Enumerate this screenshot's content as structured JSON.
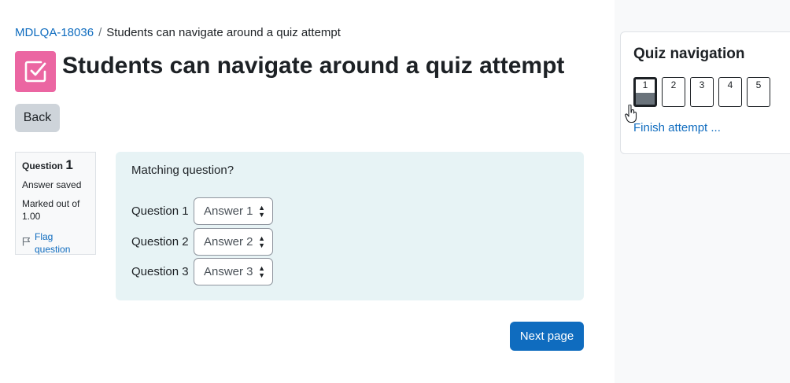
{
  "breadcrumb": {
    "course": "MDLQA-18036",
    "separator": "/",
    "current": "Students can navigate around a quiz attempt"
  },
  "page": {
    "title": "Students can navigate around a quiz attempt",
    "icon": "quiz-checkbox-icon",
    "back_label": "Back"
  },
  "question_info": {
    "label": "Question",
    "number": "1",
    "state": "Answer saved",
    "mark": "Marked out of 1.00",
    "flag_label": "Flag question"
  },
  "question": {
    "text": "Matching question?",
    "rows": [
      {
        "label": "Question 1",
        "selected": "Answer 1"
      },
      {
        "label": "Question 2",
        "selected": "Answer 2"
      },
      {
        "label": "Question 3",
        "selected": "Answer 3"
      }
    ]
  },
  "next_label": "Next page",
  "navigation": {
    "title": "Quiz navigation",
    "buttons": [
      "1",
      "2",
      "3",
      "4",
      "5"
    ],
    "current": "1",
    "finish_label": "Finish attempt ..."
  },
  "colors": {
    "accent": "#0f6cbf",
    "quiz_icon": "#eb66a2",
    "question_bg": "#e7f3f5"
  }
}
